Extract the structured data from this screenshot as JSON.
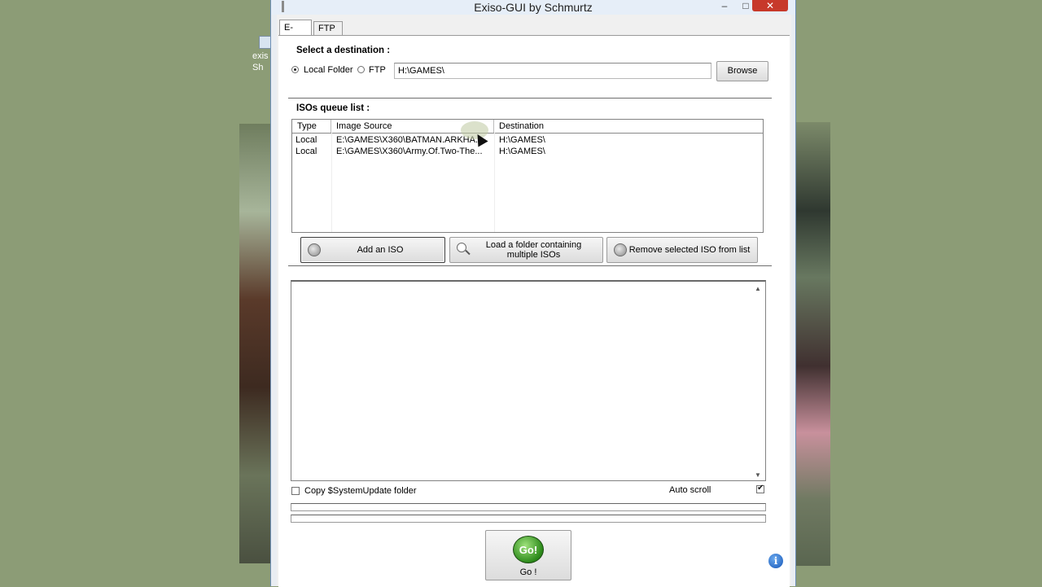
{
  "window": {
    "title": "Exiso-GUI by Schmurtz",
    "minimize_glyph": "–",
    "maximize_glyph": "□",
    "close_glyph": "✕"
  },
  "tabs": [
    {
      "label": "E-xiso",
      "active": true
    },
    {
      "label": "FTP",
      "active": false
    }
  ],
  "destination": {
    "section_label": "Select a destination :",
    "options": [
      {
        "label": "Local Folder",
        "selected": true
      },
      {
        "label": "FTP",
        "selected": false
      }
    ],
    "path_value": "H:\\GAMES\\",
    "browse_label": "Browse"
  },
  "queue": {
    "section_label": "ISOs queue list :",
    "columns": [
      "Type",
      "Image Source",
      "Destination"
    ],
    "rows": [
      {
        "type": "Local",
        "source": "E:\\GAMES\\X360\\BATMAN.ARKHA...",
        "destination": "H:\\GAMES\\"
      },
      {
        "type": "Local",
        "source": "E:\\GAMES\\X360\\Army.Of.Two-The...",
        "destination": "H:\\GAMES\\"
      }
    ]
  },
  "actions": {
    "add_iso": "Add an ISO",
    "load_folder": "Load a folder containing multiple ISOs",
    "remove_iso": "Remove selected ISO from list"
  },
  "options": {
    "copy_system_update": {
      "label": "Copy $SystemUpdate folder",
      "checked": false
    },
    "auto_scroll": {
      "label": "Auto scroll",
      "checked": true
    }
  },
  "go": {
    "icon_text": "Go!",
    "label": "Go !"
  },
  "info_icon_glyph": "i",
  "desktop": {
    "icon_caption_1": "exis",
    "icon_caption_2": "Sh"
  },
  "colors": {
    "close_button": "#c7392a",
    "go_green": "#2c8a1a",
    "info_blue": "#1757b8",
    "desktop_bg": "#8c9c76"
  }
}
